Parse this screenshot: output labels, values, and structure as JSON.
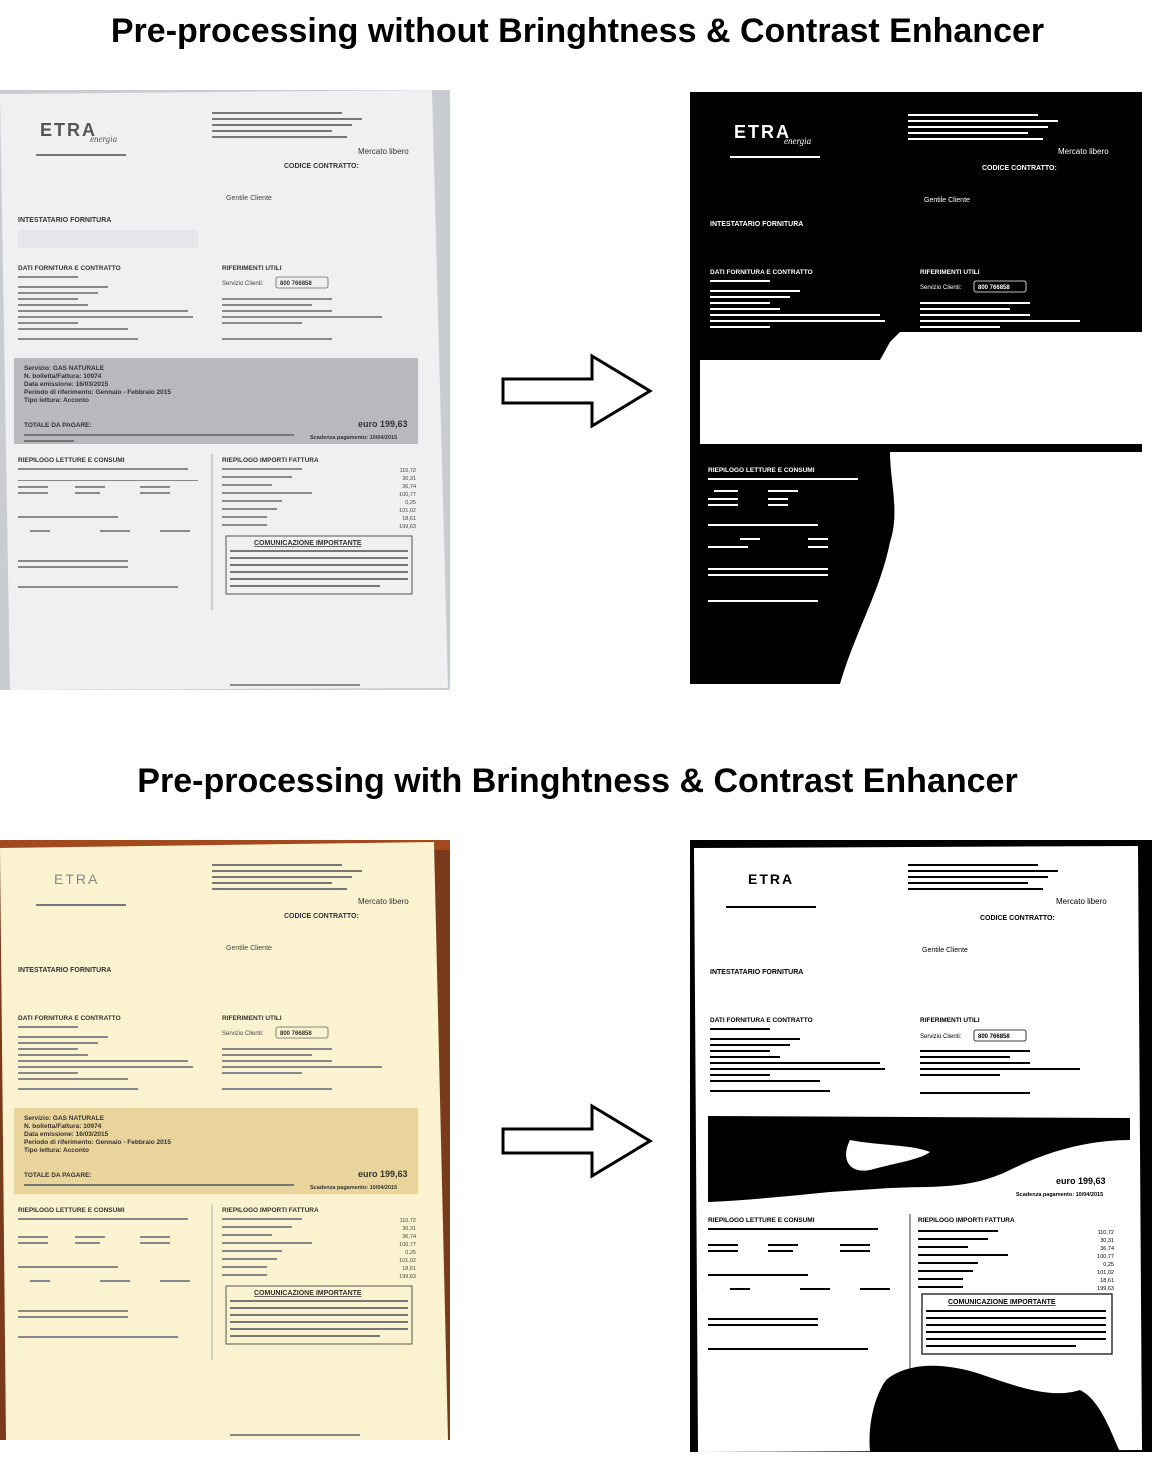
{
  "headings": {
    "top": "Pre-processing without Bringhtness & Contrast Enhancer",
    "bottom": "Pre-processing with Bringhtness & Contrast Enhancer"
  },
  "document": {
    "logo": "ETRA",
    "logo_sub": "energia",
    "market": "Mercato libero",
    "contract_code": "CODICE CONTRATTO:",
    "greeting": "Gentile Cliente",
    "holder": "INTESTATARIO FORNITURA",
    "supply_section": "DATI FORNITURA E CONTRATTO",
    "references": "RIFERIMENTI UTILI",
    "service_label": "Servizio Clienti:",
    "phone": "800 766858",
    "service": "Servizio: GAS NATURALE",
    "invoice_no": "N. bolletta/Fattura: 10974",
    "issue_date": "Data emissione: 16/03/2015",
    "period": "Periodo di riferimento: Gennaio - Febbraio 2015",
    "reading_type": "Tipo lettura: Acconto",
    "total_label": "TOTALE DA PAGARE:",
    "total_value": "euro 199,63",
    "due_date": "Scadenza pagamento: 10/04/2015",
    "readings_section": "RIEPILOGO LETTURE E CONSUMI",
    "amounts_section": "RIEPILOGO IMPORTI FATTURA",
    "notice_title": "COMUNICAZIONE IMPORTANTE",
    "amounts": [
      "110,72",
      "30,31",
      "36,74",
      "100,77",
      "0,25",
      "101,02",
      "18,61",
      "199,63"
    ]
  },
  "colors": {
    "doc_paper_dim": "#eef0f2",
    "doc_paper_warm": "#fbf3cf",
    "wood": "#7a3a1c",
    "desk_grey": "#cfd2d6"
  }
}
